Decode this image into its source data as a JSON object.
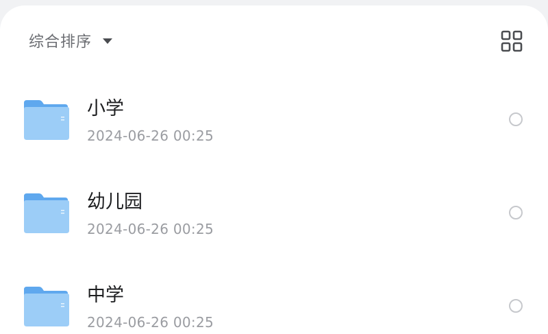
{
  "toolbar": {
    "sort_label": "综合排序",
    "sort_caret_icon": "caret-down-icon",
    "view_toggle_icon": "grid-view-icon"
  },
  "folders": [
    {
      "name": "小学",
      "date": "2024-06-26 00:25",
      "icon": "folder-icon"
    },
    {
      "name": "幼儿园",
      "date": "2024-06-26 00:25",
      "icon": "folder-icon"
    },
    {
      "name": "中学",
      "date": "2024-06-26 00:25",
      "icon": "folder-icon"
    }
  ],
  "colors": {
    "folder_back": "#5fa8ee",
    "folder_front": "#9ccdf7",
    "background": "#f1f2f4",
    "panel": "#ffffff"
  }
}
